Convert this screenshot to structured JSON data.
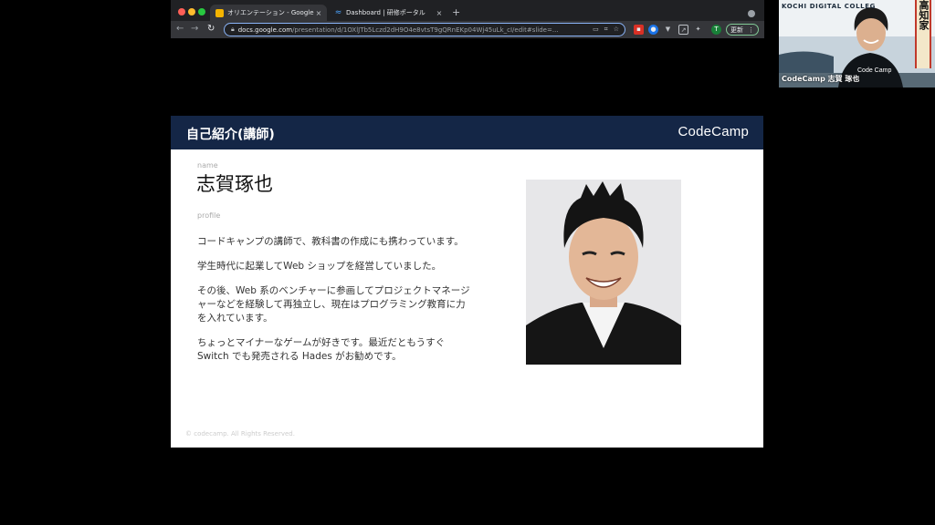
{
  "browser": {
    "tabs": [
      {
        "title": "オリエンテーション - Google ス",
        "active": true,
        "favicon": "google-slides-icon"
      },
      {
        "title": "Dashboard | 研修ポータル",
        "active": false,
        "favicon": "dashboard-icon"
      }
    ],
    "close_glyph": "×",
    "new_tab_glyph": "+",
    "url_host": "docs.google.com",
    "url_path": "/presentation/d/1OXlJTb5Lczd2dH9O4e8vtsT9gQRnEKp04Wj45uLk_cI/edit#slide=...",
    "profile_initial": "T",
    "update_label": "更新"
  },
  "slide": {
    "title": "自己紹介(講師)",
    "logo_text": "CodeCamp",
    "name_label": "name",
    "speaker_name": "志賀琢也",
    "profile_label": "profile",
    "bio": [
      "コードキャンプの講師で、教科書の作成にも携わっています。",
      "学生時代に起業してWeb ショップを経営していました。",
      "その後、Web 系のベンチャーに参画してプロジェクトマネージャーなどを経験して再独立し、現在はプログラミング教育に力を入れています。",
      "ちょっとマイナーなゲームが好きです。最近だともうすぐSwitch でも発売される Hades がお勧めです。"
    ],
    "copyright": "© codecamp. All Rights Reserved."
  },
  "webcam": {
    "participant_label": "CodeCamp 志賀 琢也",
    "sign_text": "KOCHI DIGITAL COLLEG",
    "banner_text": "高知家"
  },
  "colors": {
    "slide_header": "#142646",
    "browser_frame": "#202124",
    "toolbar": "#35363a",
    "accent": "#8ab4f8"
  }
}
